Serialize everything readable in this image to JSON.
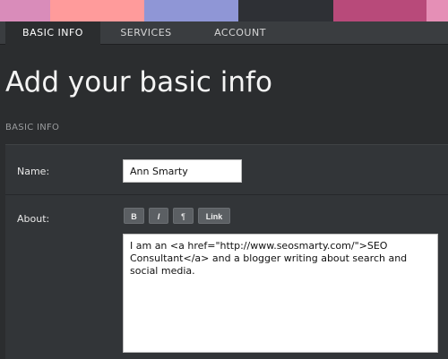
{
  "colors": {
    "strip": [
      "#d98cba",
      "#ff9b9b",
      "#8f96d6",
      "#2e3035",
      "#b84a7a",
      "#e58fb6"
    ],
    "tab_bar": "#3a3d40",
    "active_tab": "#2b2d2f",
    "page_bg": "#2b2d2f"
  },
  "tabs": [
    {
      "label": "BASIC INFO",
      "active": true
    },
    {
      "label": "SERVICES",
      "active": false
    },
    {
      "label": "ACCOUNT",
      "active": false
    }
  ],
  "page": {
    "title": "Add your basic info",
    "section_label": "BASIC INFO"
  },
  "form": {
    "name": {
      "label": "Name:",
      "value": "Ann Smarty"
    },
    "about": {
      "label": "About:",
      "value": "I am an <a href=\"http://www.seosmarty.com/\">SEO Consultant</a> and a blogger writing about search and social media."
    },
    "toolbar": {
      "bold": "B",
      "italic": "I",
      "paragraph": "¶",
      "link": "Link"
    }
  }
}
